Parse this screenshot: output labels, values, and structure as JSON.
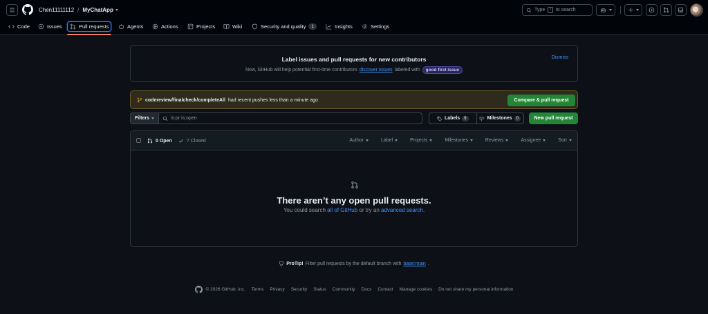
{
  "header": {
    "owner": "Chen11111112",
    "separator": "/",
    "repo": "MyChatApp",
    "search": {
      "type": "Type",
      "key": "/",
      "to_search": "to search"
    }
  },
  "nav": {
    "tabs": [
      {
        "label": "Code",
        "icon": "code-icon"
      },
      {
        "label": "Issues",
        "icon": "issue-opened-icon"
      },
      {
        "label": "Pull requests",
        "icon": "git-pull-request-icon",
        "active": true
      },
      {
        "label": "Agents",
        "icon": "agent-icon"
      },
      {
        "label": "Actions",
        "icon": "play-icon"
      },
      {
        "label": "Projects",
        "icon": "table-icon"
      },
      {
        "label": "Wiki",
        "icon": "book-icon"
      },
      {
        "label": "Security and quality",
        "icon": "shield-icon",
        "counter": "1"
      },
      {
        "label": "Insights",
        "icon": "graph-icon"
      },
      {
        "label": "Settings",
        "icon": "gear-icon"
      }
    ]
  },
  "banner": {
    "title": "Label issues and pull requests for new contributors",
    "text_before": "Now, GitHub will help potential first-time contributors",
    "link": "discover issues",
    "text_after": "labeled with",
    "label": "good first issue",
    "dismiss": "Dismiss"
  },
  "push": {
    "branch": "codereview/finalcheck/completeAll",
    "message": "had recent pushes less than a minute ago",
    "button": "Compare & pull request"
  },
  "filters": {
    "button": "Filters",
    "query": "is:pr is:open",
    "labels": "Labels",
    "labels_count": "9",
    "milestones": "Milestones",
    "milestones_count": "0",
    "new_pr": "New pull request"
  },
  "list": {
    "open": "0 Open",
    "closed": "7 Closed",
    "menus": [
      "Author",
      "Label",
      "Projects",
      "Milestones",
      "Reviews",
      "Assignee",
      "Sort"
    ],
    "empty_title": "There aren’t any open pull requests.",
    "empty_before": "You could search",
    "empty_link1": "all of GitHub",
    "empty_mid": "or try an",
    "empty_link2": "advanced search",
    "empty_end": "."
  },
  "protip": {
    "label": "ProTip!",
    "text": "Filter pull requests by the default branch with",
    "link": "base:main",
    "end": "."
  },
  "footer": {
    "copyright": "© 2026 GitHub, Inc.",
    "links": [
      "Terms",
      "Privacy",
      "Security",
      "Status",
      "Community",
      "Docs",
      "Contact",
      "Manage cookies",
      "Do not share my personal information"
    ]
  },
  "colors": {
    "accent": "#4493f8",
    "green_button": "#238636",
    "active_underline": "#f78166"
  }
}
